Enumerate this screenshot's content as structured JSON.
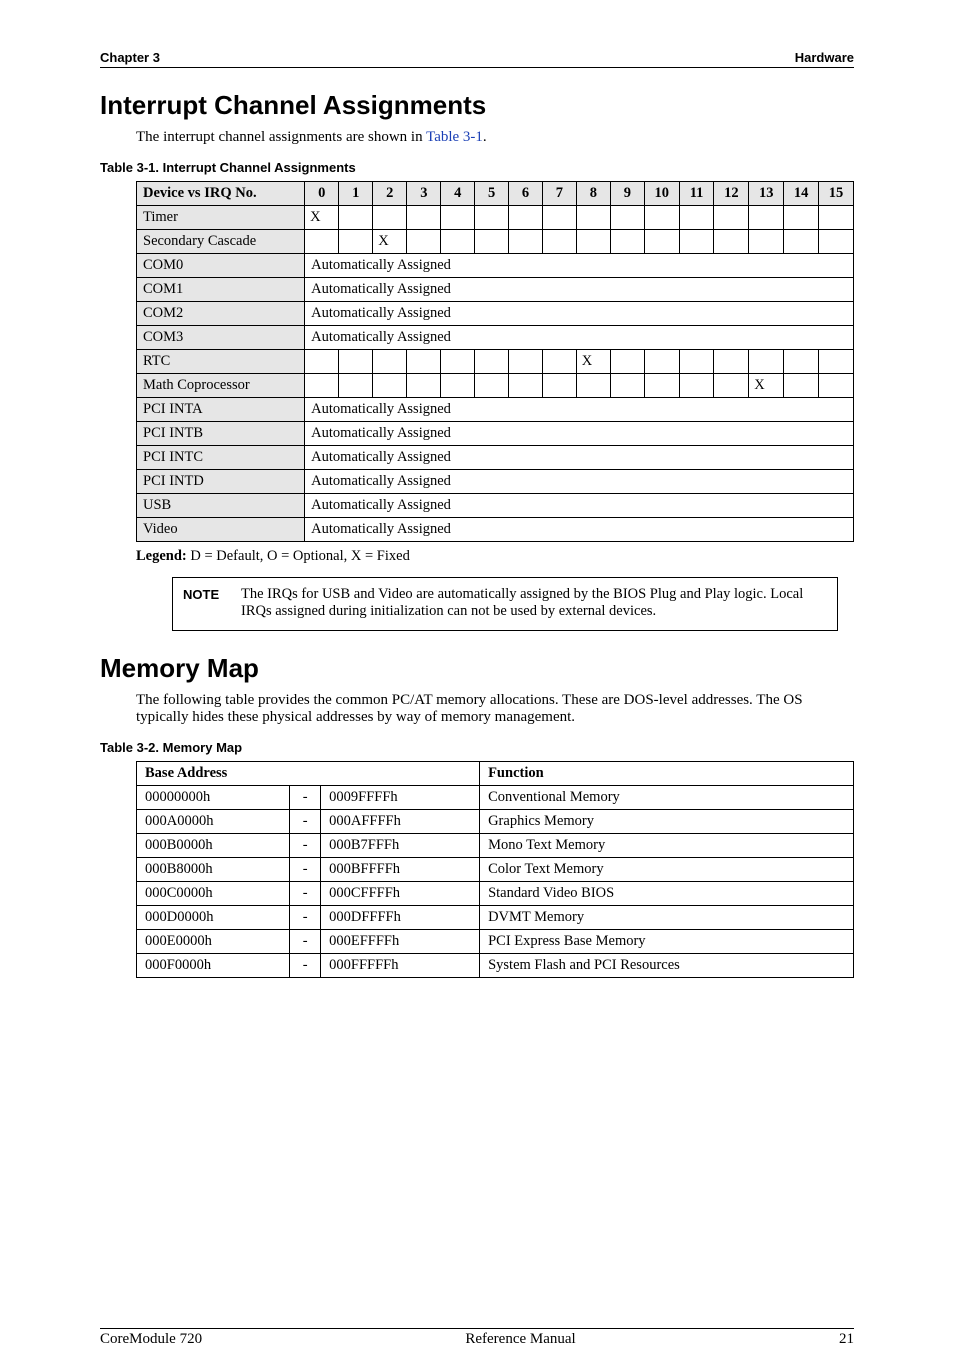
{
  "header": {
    "left": "Chapter 3",
    "right": "Hardware"
  },
  "section1": {
    "title": "Interrupt Channel Assignments",
    "intro_pre": "The interrupt channel assignments are shown in ",
    "intro_link": "Table 3-1",
    "intro_post": ".",
    "caption": "Table 3-1.   Interrupt Channel Assignments",
    "th_device": "Device vs IRQ No.",
    "irqs": [
      "0",
      "1",
      "2",
      "3",
      "4",
      "5",
      "6",
      "7",
      "8",
      "9",
      "10",
      "11",
      "12",
      "13",
      "14",
      "15"
    ],
    "rows": [
      {
        "device": "Timer",
        "cells": [
          "X",
          "",
          "",
          "",
          "",
          "",
          "",
          "",
          "",
          "",
          "",
          "",
          "",
          "",
          "",
          ""
        ]
      },
      {
        "device": "Secondary Cascade",
        "cells": [
          "",
          "",
          "X",
          "",
          "",
          "",
          "",
          "",
          "",
          "",
          "",
          "",
          "",
          "",
          "",
          ""
        ]
      },
      {
        "device": "COM0",
        "span": "Automatically Assigned"
      },
      {
        "device": "COM1",
        "span": "Automatically Assigned"
      },
      {
        "device": "COM2",
        "span": "Automatically Assigned"
      },
      {
        "device": "COM3",
        "span": "Automatically Assigned"
      },
      {
        "device": "RTC",
        "cells": [
          "",
          "",
          "",
          "",
          "",
          "",
          "",
          "",
          "X",
          "",
          "",
          "",
          "",
          "",
          "",
          ""
        ]
      },
      {
        "device": "Math Coprocessor",
        "cells": [
          "",
          "",
          "",
          "",
          "",
          "",
          "",
          "",
          "",
          "",
          "",
          "",
          "",
          "X",
          "",
          ""
        ]
      },
      {
        "device": "PCI INTA",
        "span": "Automatically Assigned"
      },
      {
        "device": "PCI INTB",
        "span": "Automatically Assigned"
      },
      {
        "device": "PCI INTC",
        "span": "Automatically Assigned"
      },
      {
        "device": "PCI INTD",
        "span": "Automatically Assigned"
      },
      {
        "device": "USB",
        "span": "Automatically Assigned"
      },
      {
        "device": "Video",
        "span": "Automatically Assigned"
      }
    ],
    "legend_label": "Legend:",
    "legend_text": " D = Default, O = Optional, X = Fixed",
    "note_label": "NOTE",
    "note_text": "The IRQs for USB and Video are automatically assigned by the BIOS Plug and Play logic. Local IRQs assigned during initialization can not be used by external devices."
  },
  "section2": {
    "title": "Memory Map",
    "intro": "The following table provides the common PC/AT memory allocations. These are DOS-level addresses. The OS typically hides these physical addresses by way of memory management.",
    "caption": "Table 3-2.   Memory Map",
    "th_base": "Base Address",
    "th_func": "Function",
    "rows": [
      {
        "from": "00000000h",
        "to": "0009FFFFh",
        "func": "Conventional Memory"
      },
      {
        "from": "000A0000h",
        "to": "000AFFFFh",
        "func": "Graphics Memory"
      },
      {
        "from": "000B0000h",
        "to": "000B7FFFh",
        "func": "Mono Text Memory"
      },
      {
        "from": "000B8000h",
        "to": "000BFFFFh",
        "func": "Color Text Memory"
      },
      {
        "from": "000C0000h",
        "to": "000CFFFFh",
        "func": "Standard Video BIOS"
      },
      {
        "from": "000D0000h",
        "to": "000DFFFFh",
        "func": "DVMT Memory"
      },
      {
        "from": "000E0000h",
        "to": "000EFFFFh",
        "func": "PCI Express Base Memory"
      },
      {
        "from": "000F0000h",
        "to": "000FFFFFh",
        "func": "System Flash and PCI Resources"
      }
    ]
  },
  "footer": {
    "left": "CoreModule 720",
    "center": "Reference Manual",
    "right": "21"
  }
}
